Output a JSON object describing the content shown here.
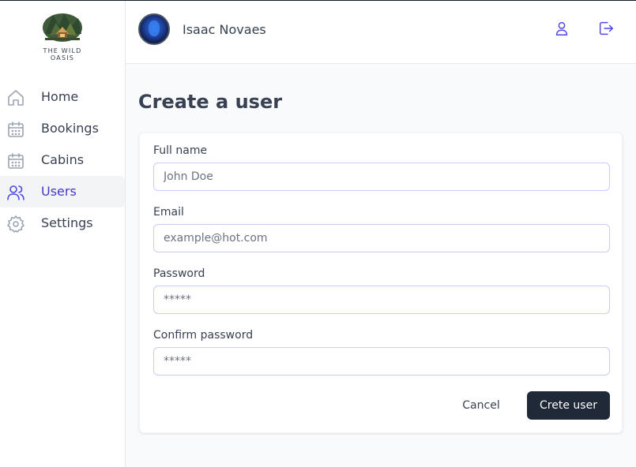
{
  "brand": {
    "name": "THE WILD OASIS",
    "logo_icon": "mountain-cabin-logo"
  },
  "sidebar": {
    "items": [
      {
        "label": "Home",
        "icon": "home-icon",
        "active": false
      },
      {
        "label": "Bookings",
        "icon": "calendar-icon",
        "active": false
      },
      {
        "label": "Cabins",
        "icon": "calendar-icon",
        "active": false
      },
      {
        "label": "Users",
        "icon": "users-icon",
        "active": true
      },
      {
        "label": "Settings",
        "icon": "gear-icon",
        "active": false
      }
    ]
  },
  "header": {
    "user_name": "Isaac Novaes",
    "account_icon": "user-icon",
    "logout_icon": "logout-icon"
  },
  "page": {
    "title": "Create a user"
  },
  "form": {
    "full_name": {
      "label": "Full name",
      "placeholder": "John Doe",
      "value": ""
    },
    "email": {
      "label": "Email",
      "placeholder": "example@hot.com",
      "value": ""
    },
    "password": {
      "label": "Password",
      "placeholder": "*****",
      "value": ""
    },
    "confirm_password": {
      "label": "Confirm password",
      "placeholder": "*****",
      "value": ""
    },
    "cancel_label": "Cancel",
    "submit_label": "Crete user"
  },
  "colors": {
    "accent": "#4f46e5",
    "dark_button": "#1f2937",
    "input_border": "#c7cdf5",
    "active_bg": "#f3f4f6"
  }
}
